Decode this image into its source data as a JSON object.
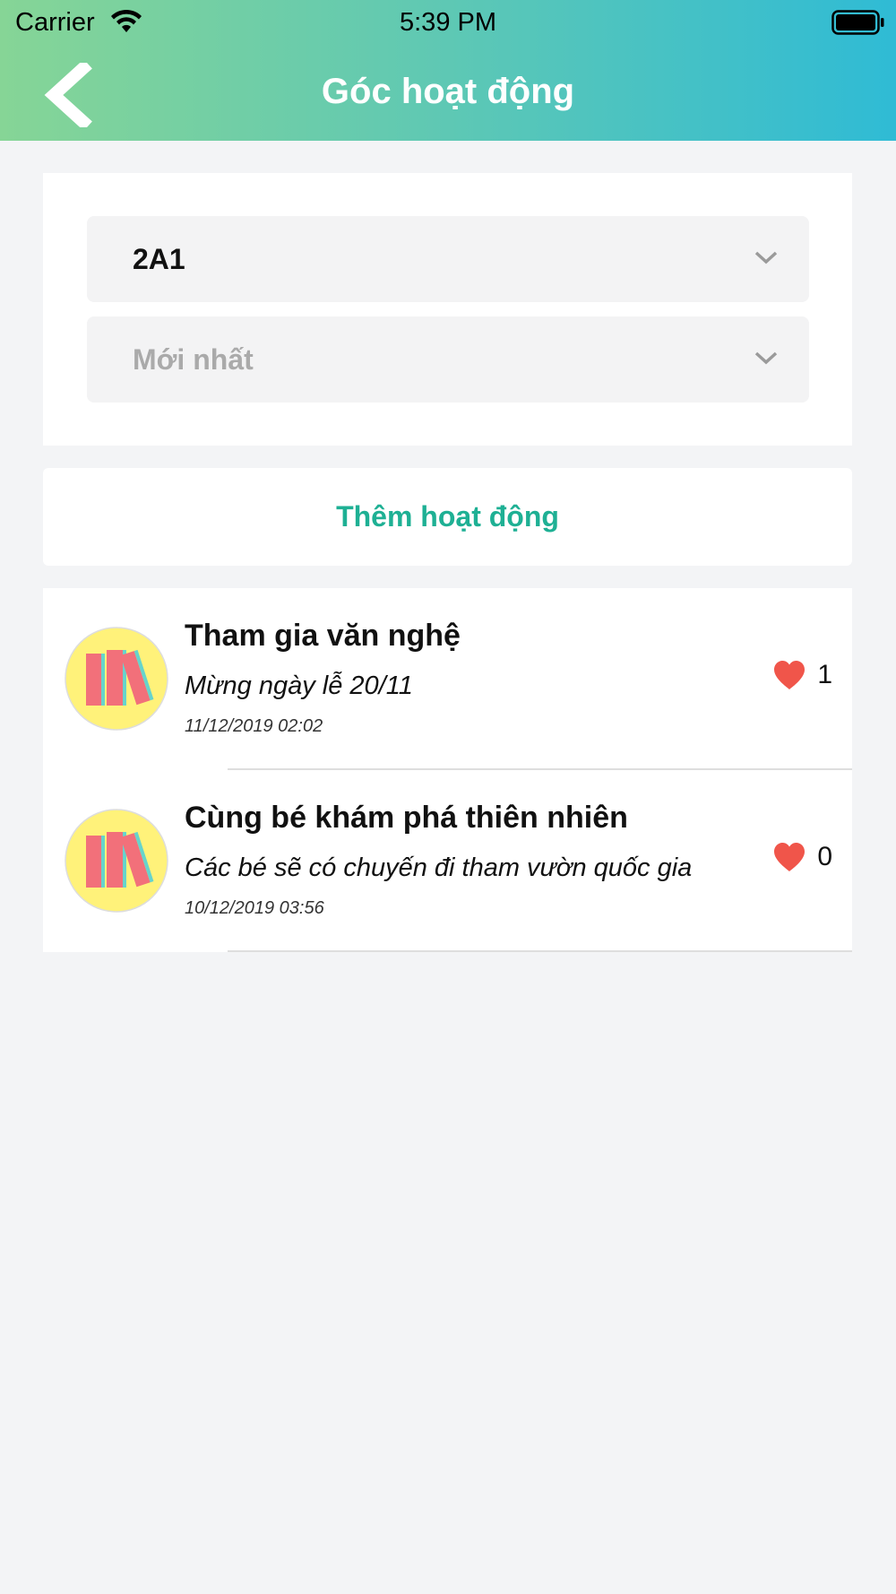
{
  "status_bar": {
    "carrier": "Carrier",
    "time": "5:39 PM",
    "wifi_icon": "wifi-icon",
    "battery_icon": "battery-icon"
  },
  "header": {
    "title": "Góc hoạt động",
    "back_icon": "chevron-left-icon"
  },
  "filters": {
    "class_select": {
      "value": "2A1",
      "icon": "chevron-down-icon"
    },
    "sort_select": {
      "value": "Mới nhất",
      "icon": "chevron-down-icon"
    }
  },
  "add_activity": {
    "label": "Thêm hoạt động"
  },
  "activities": [
    {
      "title": "Tham gia văn nghệ",
      "description": "Mừng ngày lễ 20/11",
      "date": "11/12/2019 02:02",
      "likes": "1",
      "avatar_icon": "books-icon",
      "like_icon": "heart-icon"
    },
    {
      "title": "Cùng bé khám phá thiên nhiên",
      "description": "Các bé sẽ có chuyến đi tham vườn quốc gia",
      "date": "10/12/2019 03:56",
      "likes": "0",
      "avatar_icon": "books-icon",
      "like_icon": "heart-icon"
    }
  ],
  "colors": {
    "header_gradient_start": "#86d596",
    "header_gradient_end": "#2fbbd5",
    "accent": "#1eb094",
    "heart": "#f0554a",
    "avatar_bg": "#fff27a"
  }
}
